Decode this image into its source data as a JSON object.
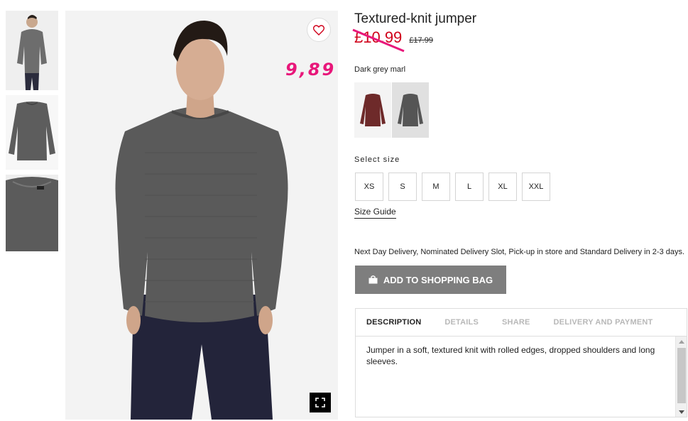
{
  "product": {
    "title": "Textured-knit jumper",
    "price_new": "£10.99",
    "price_old": "£17.99",
    "colour_name": "Dark grey marl"
  },
  "annotation": "9,89",
  "colours": [
    {
      "name": "burgundy",
      "color": "#6e2a2a"
    },
    {
      "name": "dark-grey-marl",
      "color": "#555555",
      "selected": true
    }
  ],
  "size_section": {
    "label": "Select size",
    "sizes": [
      "XS",
      "S",
      "M",
      "L",
      "XL",
      "XXL"
    ],
    "guide_label": "Size Guide"
  },
  "delivery_text": "Next Day Delivery, Nominated Delivery Slot, Pick-up in store and Standard Delivery in 2-3 days.",
  "add_to_bag_label": "ADD TO SHOPPING BAG",
  "tabs": [
    {
      "label": "DESCRIPTION",
      "active": true
    },
    {
      "label": "DETAILS"
    },
    {
      "label": "SHARE"
    },
    {
      "label": "DELIVERY AND PAYMENT"
    }
  ],
  "description": "Jumper in a soft, textured knit with rolled edges, dropped shoulders and long sleeves.",
  "colors": {
    "sale_red": "#d0021b",
    "annotation_pink": "#e8177a",
    "button_grey": "#7e7e7e"
  },
  "icons": {
    "favourite": "heart-icon",
    "expand": "fullscreen-icon",
    "bag": "shopping-bag-icon"
  }
}
